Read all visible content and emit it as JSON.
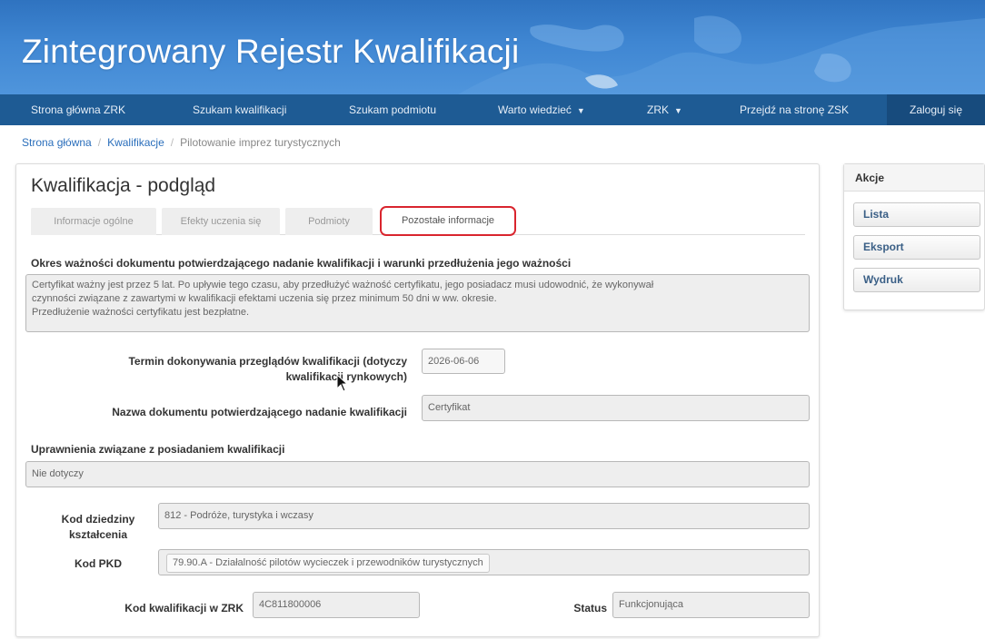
{
  "header": {
    "title": "Zintegrowany Rejestr Kwalifikacji"
  },
  "nav": {
    "items": [
      {
        "label": "Strona główna ZRK",
        "dropdown": false
      },
      {
        "label": "Szukam kwalifikacji",
        "dropdown": false
      },
      {
        "label": "Szukam podmiotu",
        "dropdown": false
      },
      {
        "label": "Warto wiedzieć",
        "dropdown": true
      },
      {
        "label": "ZRK",
        "dropdown": true
      },
      {
        "label": "Przejdź na stronę ZSK",
        "dropdown": false
      }
    ],
    "login": "Zaloguj się"
  },
  "breadcrumb": {
    "home": "Strona główna",
    "section": "Kwalifikacje",
    "current": "Pilotowanie imprez turystycznych"
  },
  "page": {
    "title": "Kwalifikacja - podgląd",
    "tabs": [
      {
        "label": "Informacje ogólne",
        "active": false
      },
      {
        "label": "Efekty uczenia się",
        "active": false
      },
      {
        "label": "Podmioty",
        "active": false
      },
      {
        "label": "Pozostałe informacje",
        "active": true
      }
    ],
    "validity": {
      "heading": "Okres ważności dokumentu potwierdzającego nadanie kwalifikacji i warunki przedłużenia jego ważności",
      "line1": "Certyfikat ważny jest przez 5 lat. Po upływie tego czasu, aby przedłużyć ważność certyfikatu, jego posiadacz musi udowodnić, że wykonywał",
      "line2": "czynności związane z zawartymi w kwalifikacji efektami uczenia się przez minimum 50 dni w ww. okresie.",
      "line3": "Przedłużenie ważności certyfikatu jest bezpłatne."
    },
    "review": {
      "label_line1": "Termin dokonywania przeglądów kwalifikacji (dotyczy",
      "label_line2": "kwalifikacji rynkowych)",
      "value": "2026-06-06"
    },
    "document_name": {
      "label": "Nazwa dokumentu potwierdzającego nadanie kwalifikacji",
      "value": "Certyfikat"
    },
    "rights": {
      "heading": "Uprawnienia związane z posiadaniem kwalifikacji",
      "value": "Nie dotyczy"
    },
    "field_code": {
      "label_line1": "Kod dziedziny",
      "label_line2": "kształcenia",
      "value": "812 - Podróże, turystyka i wczasy"
    },
    "pkd": {
      "label": "Kod PKD",
      "value": "79.90.A - Działalność pilotów wycieczek i przewodników turystycznych"
    },
    "zrk_code": {
      "label": "Kod kwalifikacji w ZRK",
      "value": "4C811800006"
    },
    "status": {
      "label": "Status",
      "value": "Funkcjonująca"
    }
  },
  "actions": {
    "heading": "Akcje",
    "buttons": [
      "Lista",
      "Eksport",
      "Wydruk"
    ]
  },
  "colors": {
    "navbar": "#1e5b94",
    "banner": "#3f86d2",
    "highlight": "#d9252e"
  }
}
